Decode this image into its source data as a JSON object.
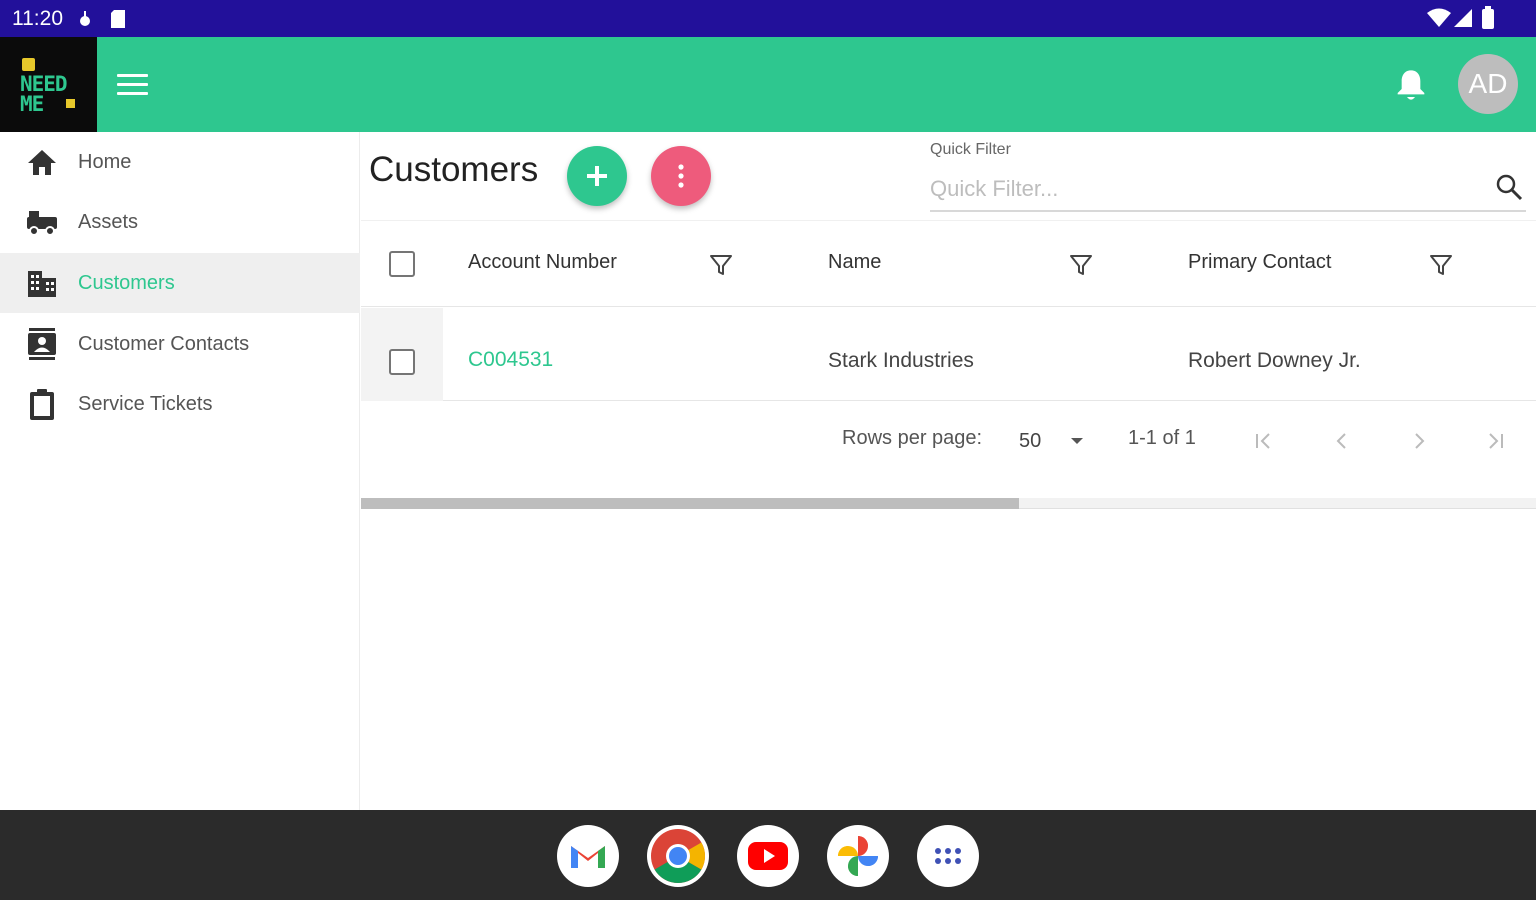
{
  "status_bar": {
    "time": "11:20"
  },
  "app_bar": {
    "logo_line1": "NEED",
    "logo_line2": "ME",
    "avatar_initials": "AD",
    "brand_color": "#2ec78f"
  },
  "sidebar": {
    "items": [
      {
        "label": "Home",
        "icon": "home-icon",
        "active": false
      },
      {
        "label": "Assets",
        "icon": "assets-icon",
        "active": false
      },
      {
        "label": "Customers",
        "icon": "building-icon",
        "active": true
      },
      {
        "label": "Customer Contacts",
        "icon": "contacts-icon",
        "active": false
      },
      {
        "label": "Service Tickets",
        "icon": "clipboard-icon",
        "active": false
      }
    ]
  },
  "main": {
    "title": "Customers",
    "add_fab_glyph": "+",
    "more_fab_glyph": "⋮",
    "quick_filter": {
      "label": "Quick Filter",
      "placeholder": "Quick Filter...",
      "value": ""
    },
    "columns": [
      {
        "label": "Account Number"
      },
      {
        "label": "Name"
      },
      {
        "label": "Primary Contact"
      }
    ],
    "rows": [
      {
        "account_number": "C004531",
        "name": "Stark Industries",
        "primary_contact": "Robert Downey Jr."
      }
    ],
    "pagination": {
      "rows_per_page_label": "Rows per page:",
      "rows_per_page": "50",
      "range": "1-1 of 1"
    },
    "horizontal_scroll_fraction": 0.56
  },
  "dock": {
    "apps": [
      "Gmail",
      "Chrome",
      "YouTube",
      "Photos",
      "App drawer"
    ]
  }
}
